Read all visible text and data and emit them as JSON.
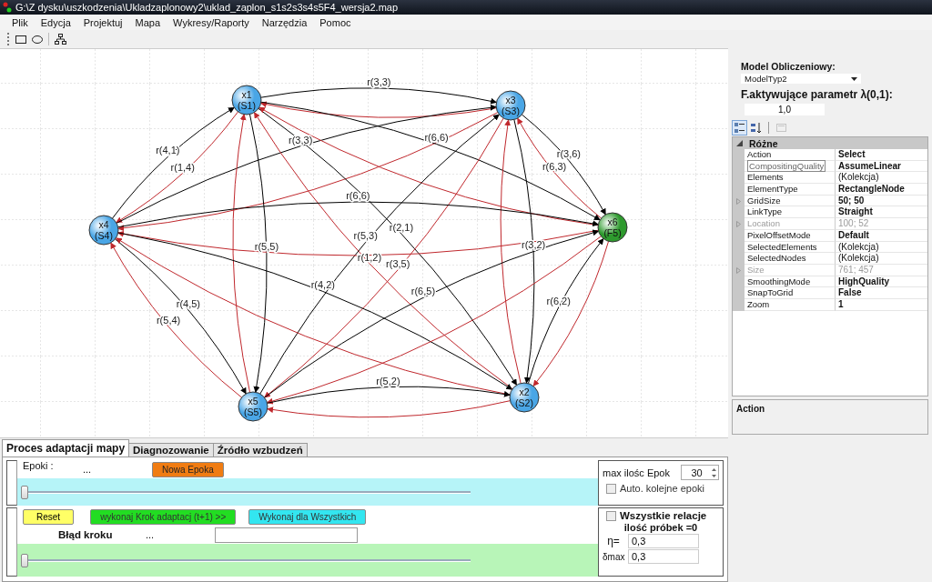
{
  "window": {
    "title": "G:\\Z dysku\\uszkodzenia\\Ukladzaplonowy2\\uklad_zaplon_s1s2s3s4s5F4_wersja2.map"
  },
  "menu": [
    "Plik",
    "Edycja",
    "Projektuj",
    "Mapa",
    "Wykresy/Raporty",
    "Narzędzia",
    "Pomoc"
  ],
  "map": {
    "nodes": [
      {
        "name": "x1",
        "state": "(S1)",
        "color": "#4aa6e6"
      },
      {
        "name": "x2",
        "state": "(S2)",
        "color": "#4aa6e6"
      },
      {
        "name": "x3",
        "state": "(S3)",
        "color": "#4aa6e6"
      },
      {
        "name": "x4",
        "state": "(S4)",
        "color": "#4aa6e6"
      },
      {
        "name": "x5",
        "state": "(S5)",
        "color": "#4aa6e6"
      },
      {
        "name": "x6",
        "state": "(F5)",
        "color": "#2e9a2e"
      }
    ],
    "links": [
      {
        "kind": "forward",
        "label": "r(4,1)"
      },
      {
        "kind": "reverse",
        "label": "r(1,4)"
      },
      {
        "kind": "forward",
        "label": "r(3,3)"
      },
      {
        "kind": "reverse"
      },
      {
        "kind": "forward",
        "label": "r(3,3)"
      },
      {
        "kind": "reverse"
      },
      {
        "kind": "forward",
        "label": "r(5,5)"
      },
      {
        "kind": "reverse"
      },
      {
        "kind": "forward",
        "label": "r(2,1)"
      },
      {
        "kind": "reverse",
        "label": "r(1,2)"
      },
      {
        "kind": "forward",
        "label": "r(6,6)"
      },
      {
        "kind": "reverse"
      },
      {
        "kind": "reverse",
        "label": "r(6,3)"
      },
      {
        "kind": "forward",
        "label": "r(3,6)"
      },
      {
        "kind": "forward",
        "label": "r(5,3)"
      },
      {
        "kind": "reverse",
        "label": "r(3,5)"
      },
      {
        "kind": "forward",
        "label": "r(3,2)"
      },
      {
        "kind": "reverse"
      },
      {
        "kind": "forward",
        "label": "r(6,6)"
      },
      {
        "kind": "reverse"
      },
      {
        "kind": "forward",
        "label": "r(4,5)"
      },
      {
        "kind": "reverse",
        "label": "r(5,4)"
      },
      {
        "kind": "forward",
        "label": "r(4,2)"
      },
      {
        "kind": "reverse"
      },
      {
        "kind": "forward",
        "label": "r(6,5)"
      },
      {
        "kind": "reverse"
      },
      {
        "kind": "forward",
        "label": "r(6,2)"
      },
      {
        "kind": "reverse"
      },
      {
        "kind": "forward",
        "label": "r(5,2)"
      },
      {
        "kind": "reverse"
      }
    ]
  },
  "side": {
    "model_label": "Model Obliczeniowy:",
    "model_value": "ModelTyp2",
    "param_label": "F.aktywujące parametr λ(0,1):",
    "param_value": "1,0",
    "view_buttons": [
      {
        "kind": "categorized",
        "selected": true
      },
      {
        "kind": "alphabetical",
        "selected": false
      },
      {
        "kind": "pages",
        "selected": false,
        "disabled": true
      }
    ],
    "category": {
      "name": "Różne",
      "expanded": true
    },
    "properties": [
      {
        "name": "Action",
        "value": "Select",
        "bold": true,
        "disabled": false,
        "expandable": false,
        "hovered": false
      },
      {
        "name": "CompositingQuality",
        "value": "AssumeLinear",
        "bold": true,
        "disabled": false,
        "expandable": false,
        "hovered": true
      },
      {
        "name": "Elements",
        "value": "(Kolekcja)",
        "bold": false,
        "disabled": false,
        "expandable": false,
        "hovered": false
      },
      {
        "name": "ElementType",
        "value": "RectangleNode",
        "bold": true,
        "disabled": false,
        "expandable": false,
        "hovered": false
      },
      {
        "name": "GridSize",
        "value": "50; 50",
        "bold": true,
        "disabled": false,
        "expandable": true,
        "hovered": false
      },
      {
        "name": "LinkType",
        "value": "Straight",
        "bold": true,
        "disabled": false,
        "expandable": false,
        "hovered": false
      },
      {
        "name": "Location",
        "value": "100; 52",
        "bold": false,
        "disabled": true,
        "expandable": true,
        "hovered": false
      },
      {
        "name": "PixelOffsetMode",
        "value": "Default",
        "bold": true,
        "disabled": false,
        "expandable": false,
        "hovered": false
      },
      {
        "name": "SelectedElements",
        "value": "(Kolekcja)",
        "bold": false,
        "disabled": false,
        "expandable": false,
        "hovered": false
      },
      {
        "name": "SelectedNodes",
        "value": "(Kolekcja)",
        "bold": false,
        "disabled": false,
        "expandable": false,
        "hovered": false
      },
      {
        "name": "Size",
        "value": "761; 457",
        "bold": false,
        "disabled": true,
        "expandable": true,
        "hovered": false
      },
      {
        "name": "SmoothingMode",
        "value": "HighQuality",
        "bold": true,
        "disabled": false,
        "expandable": false,
        "hovered": false
      },
      {
        "name": "SnapToGrid",
        "value": "False",
        "bold": true,
        "disabled": false,
        "expandable": false,
        "hovered": false
      },
      {
        "name": "Zoom",
        "value": "1",
        "bold": true,
        "disabled": false,
        "expandable": false,
        "hovered": false
      }
    ],
    "description_title": "Action"
  },
  "tabs": [
    {
      "label": "Proces adaptacji mapy",
      "selected": true
    },
    {
      "label": "Diagnozowanie",
      "selected": false
    },
    {
      "label": "Źródło  wzbudzeń",
      "selected": false
    }
  ],
  "epochs": {
    "label": "Epoki :",
    "value": "...",
    "button": "Nowa Epoka",
    "level": 0,
    "max_label": "max ilośc Epok",
    "max_value": "30",
    "auto": {
      "label": "Auto. kolejne epoki",
      "checked": false
    }
  },
  "step": {
    "buttons": [
      {
        "label": "Reset",
        "kind": "reset"
      },
      {
        "label": "wykonaj Krok adaptacj (t+1) >>",
        "kind": "step"
      },
      {
        "label": "Wykonaj dla Wszystkich",
        "kind": "all"
      }
    ],
    "error_label": "Błąd kroku",
    "error_value": "...",
    "level": 0,
    "all_relations": {
      "label": "Wszystkie relacje",
      "checked": false
    },
    "samples": "ilość próbek =0",
    "eta_label": "η=",
    "eta_value": "0,3",
    "dmax_label": "δmax",
    "dmax_value": "0,3"
  }
}
